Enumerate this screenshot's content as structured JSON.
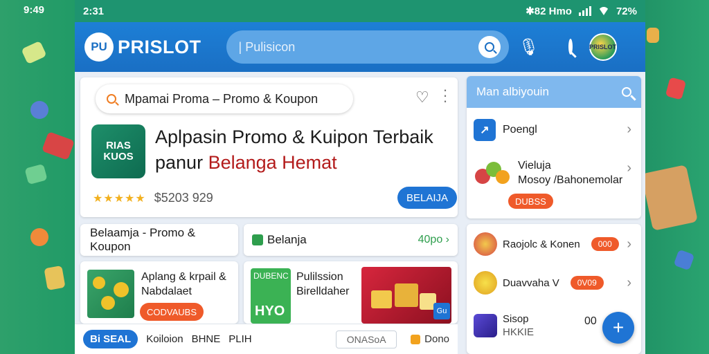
{
  "outer_time": "9:49",
  "status_bar": {
    "time": "2:31",
    "right_text": "✱82 Hmo",
    "battery_text": "72%"
  },
  "header": {
    "logo_badge": "PU",
    "app_name": "PRISLOT",
    "search_placeholder": "| Pulisicon",
    "avatar_text": "PRISLOT"
  },
  "hero": {
    "search_text": "Mpamai Proma – Promo & Koupon",
    "app_icon_text": "RIAS KUOS",
    "title_line1": "Aplpasin Promo & Kuipon Terbaik",
    "title_line2_prefix": "panur ",
    "title_line2_accent": "Belanga Hemat",
    "stars": "★★★★★",
    "price": "$5203 929",
    "button_label": "BELAIJA"
  },
  "tabs": {
    "left": "Belaamja - Promo & Koupon",
    "right": "Belanja",
    "right_more": "40po ›"
  },
  "products": [
    {
      "line1": "Aplang & krpail &",
      "line2": "Nabdalaet",
      "chip": "CODVAUBS"
    },
    {
      "img_text": "DUBENC",
      "img_big": "HYO",
      "line1": "Pulilssion",
      "line2": "Birelldaher",
      "badge": "Gu"
    }
  ],
  "bottom_bar": {
    "active": "Bi SEAL",
    "items": [
      "Koiloion",
      "BHNE",
      "PLIH"
    ],
    "field": "ONASoA",
    "done": "Dono"
  },
  "side_panel": {
    "header": "Man albiyouin",
    "row1": "Poengl",
    "row2_line1": "Vieluja",
    "row2_line2": "Mosoy /Bahonemolar",
    "row2_chip": "DUBSS"
  },
  "side_list": [
    {
      "label": "Raojolc & Konen",
      "pill": "000"
    },
    {
      "label": "Duavvaha V",
      "pill": "0V09"
    },
    {
      "label": "Sisop",
      "sub": "HKKIE",
      "count": "00"
    }
  ],
  "colors": {
    "brand_blue": "#1f74d4",
    "app_green": "#1e9470",
    "accent_red": "#b31b1b",
    "chip_orange": "#ef5a2a"
  },
  "icons": [
    "search-icon",
    "lens-icon",
    "mic-icon",
    "heart-icon",
    "more-icon",
    "chevron-right-icon",
    "plus-icon"
  ]
}
